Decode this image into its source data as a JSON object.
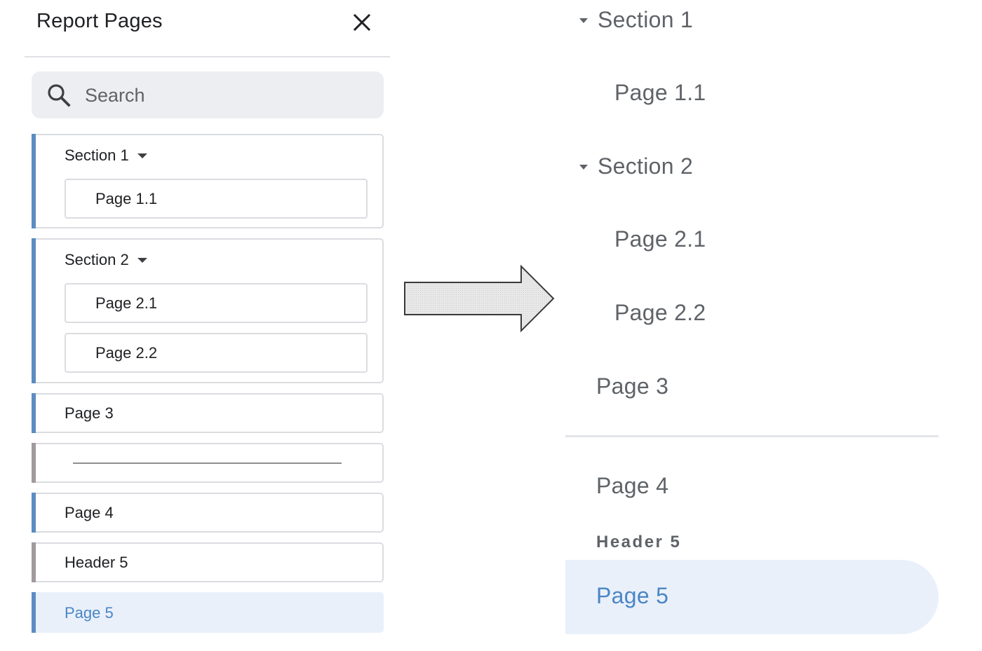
{
  "panel": {
    "title": "Report Pages",
    "search_placeholder": "Search",
    "items": [
      {
        "type": "section",
        "label": "Section 1",
        "pages": [
          "Page 1.1"
        ]
      },
      {
        "type": "section",
        "label": "Section 2",
        "pages": [
          "Page 2.1",
          "Page 2.2"
        ]
      },
      {
        "type": "page",
        "label": "Page 3"
      },
      {
        "type": "divider"
      },
      {
        "type": "page",
        "label": "Page 4"
      },
      {
        "type": "header",
        "label": "Header 5"
      },
      {
        "type": "page",
        "label": "Page 5",
        "active": true
      }
    ]
  },
  "preview": {
    "section1": "Section 1",
    "page1_1": "Page 1.1",
    "section2": "Section 2",
    "page2_1": "Page 2.1",
    "page2_2": "Page 2.2",
    "page3": "Page 3",
    "page4": "Page 4",
    "header5": "Header 5",
    "page5": "Page 5"
  },
  "colors": {
    "accent_blue": "#5b8dc0",
    "header_grey": "#a19a9e",
    "active_bg": "#eaf0fa",
    "active_text": "#4a86c5"
  },
  "icons": {
    "close": "close-icon",
    "search": "search-icon",
    "caret": "caret-down-icon",
    "arrow": "right-arrow-icon"
  }
}
